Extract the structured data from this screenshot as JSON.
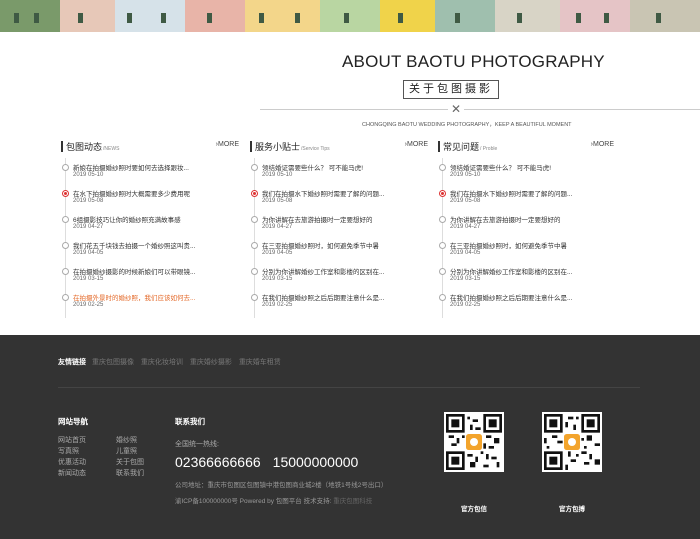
{
  "about": {
    "title": "ABOUT BAOTU PHOTOGRAPHY",
    "subtitle": "关于包图摄影",
    "close_glyph": "✕",
    "tagline": "CHONGQING BAOTU WEDDING PHOTOGRAPHY，KEEP A BEAUTIFUL MOMENT"
  },
  "columns": [
    {
      "title": "包图动态",
      "title_en": "/NEWS",
      "more": "MORE",
      "items": [
        {
          "title": "新娘在拍摄婚纱照时要如何去选择跟妆...",
          "date": "2019 05-10",
          "active": false,
          "highlight": false
        },
        {
          "title": "在水下拍摄婚纱照时大概需要多少费用呢",
          "date": "2019 05-08",
          "active": true,
          "highlight": false
        },
        {
          "title": "6组摄影技巧让你的婚纱照充满故事感",
          "date": "2019 04-27",
          "active": false,
          "highlight": false
        },
        {
          "title": "我们花五千块钱去拍摄一个婚纱照这叫贵...",
          "date": "2019 04-05",
          "active": false,
          "highlight": false
        },
        {
          "title": "在拍摄婚纱摄影的时候新娘们可以带眼镜...",
          "date": "2019 03-15",
          "active": false,
          "highlight": false
        },
        {
          "title": "在拍摄外景时的婚纱照，我们应该如何去...",
          "date": "2019 02-25",
          "active": false,
          "highlight": true
        }
      ]
    },
    {
      "title": "服务小贴士",
      "title_en": "/Service Tips",
      "more": "MORE",
      "items": [
        {
          "title": "领结婚证需要些什么？ 可不能马虎!",
          "date": "2019 05-10",
          "active": false,
          "highlight": false
        },
        {
          "title": "我们在拍摄水下婚纱照时需要了解的问题...",
          "date": "2019 05-08",
          "active": true,
          "highlight": false
        },
        {
          "title": "为你讲解在去旅游拍摄时一定要想好的",
          "date": "2019 04-27",
          "active": false,
          "highlight": false
        },
        {
          "title": "在三亚拍摄婚纱照时，如何避免季节中暑",
          "date": "2019 04-05",
          "active": false,
          "highlight": false
        },
        {
          "title": "分别为你讲解婚纱工作室和影楼的区别在...",
          "date": "2019 03-15",
          "active": false,
          "highlight": false
        },
        {
          "title": "在我们拍摄婚纱照之后后期要注意什么是...",
          "date": "2019 02-25",
          "active": false,
          "highlight": false
        }
      ]
    },
    {
      "title": "常见问题",
      "title_en": "/ Proble",
      "more": "MORE",
      "items": [
        {
          "title": "领结婚证需要些什么？ 可不能马虎!",
          "date": "2019 05-10",
          "active": false,
          "highlight": false
        },
        {
          "title": "我们在拍摄水下婚纱照时需要了解的问题...",
          "date": "2019 05-08",
          "active": true,
          "highlight": false
        },
        {
          "title": "为你讲解在去旅游拍摄时一定要想好的",
          "date": "2019 04-27",
          "active": false,
          "highlight": false
        },
        {
          "title": "在三亚拍摄婚纱照时，如何避免季节中暑",
          "date": "2019 04-05",
          "active": false,
          "highlight": false
        },
        {
          "title": "分别为你讲解婚纱工作室和影楼的区别在...",
          "date": "2019 03-15",
          "active": false,
          "highlight": false
        },
        {
          "title": "在我们拍摄婚纱照之后后期要注意什么是...",
          "date": "2019 02-25",
          "active": false,
          "highlight": false
        }
      ]
    }
  ],
  "footer": {
    "links_label": "友情链接",
    "links": [
      "重庆包图摄像",
      "重庆化妆培训",
      "重庆婚纱摄影",
      "重庆婚车租赁"
    ],
    "nav_title": "网站导航",
    "nav_items": [
      "网站首页",
      "婚纱照",
      "写真照",
      "儿童照",
      "优惠活动",
      "关于包图",
      "新闻动态",
      "联系我们"
    ],
    "contact_title": "联系我们",
    "hotline_label": "全国统一热线:",
    "phone1": "02366666666",
    "phone2": "15000000000",
    "address": "公司地址：重庆市包图区包图镇中港包图商业城2楼（地铁1号线2号出口）",
    "icp": "渝ICP备100000000号 Powered by 包图平台 技术支持: ",
    "tech": "重庆包图科技",
    "qr1_label": "官方包信",
    "qr2_label": "官方包搏"
  },
  "colors": {
    "accent_red": "#d33333",
    "highlight_orange": "#e46a2a",
    "footer_bg": "#333333"
  }
}
